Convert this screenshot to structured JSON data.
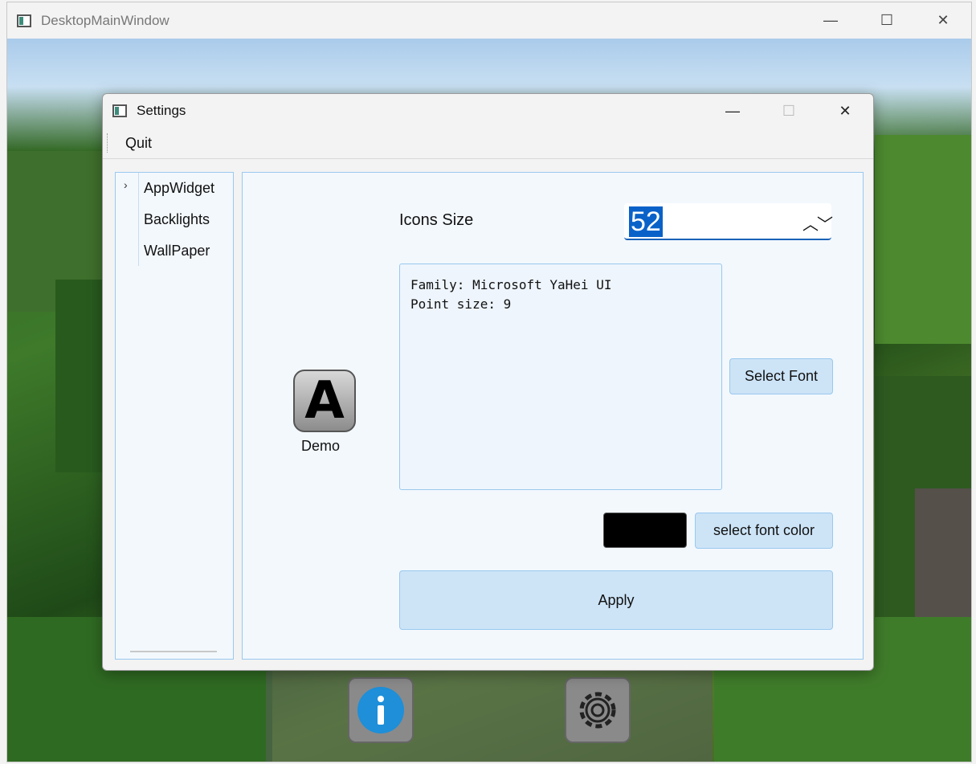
{
  "main_window": {
    "title": "DesktopMainWindow",
    "controls": {
      "minimize": "—",
      "maximize": "☐",
      "close": "✕"
    }
  },
  "dock": {
    "icons": [
      "info-icon",
      "gear-icon"
    ]
  },
  "settings": {
    "title": "Settings",
    "controls": {
      "minimize": "—",
      "maximize": "☐",
      "close": "✕"
    },
    "menu": {
      "quit": "Quit"
    },
    "nav": {
      "arrow": "›",
      "items": [
        "AppWidget",
        "Backlights",
        "WallPaper"
      ]
    },
    "content": {
      "demo_icon_letter": "A",
      "demo_label": "Demo",
      "icons_size_label": "Icons Size",
      "icons_size_value": "52",
      "spin_arrows": "︿﹀",
      "font_family_line": "Family: Microsoft YaHei UI",
      "font_size_line": "Point size: 9",
      "select_font_button": "Select Font",
      "font_color": "#000000",
      "select_font_color_button": "select font color",
      "apply_button": "Apply"
    }
  },
  "colors": {
    "accent": "#0a62c9",
    "panel_border": "#99c8ee",
    "button_bg": "#cde4f7"
  }
}
